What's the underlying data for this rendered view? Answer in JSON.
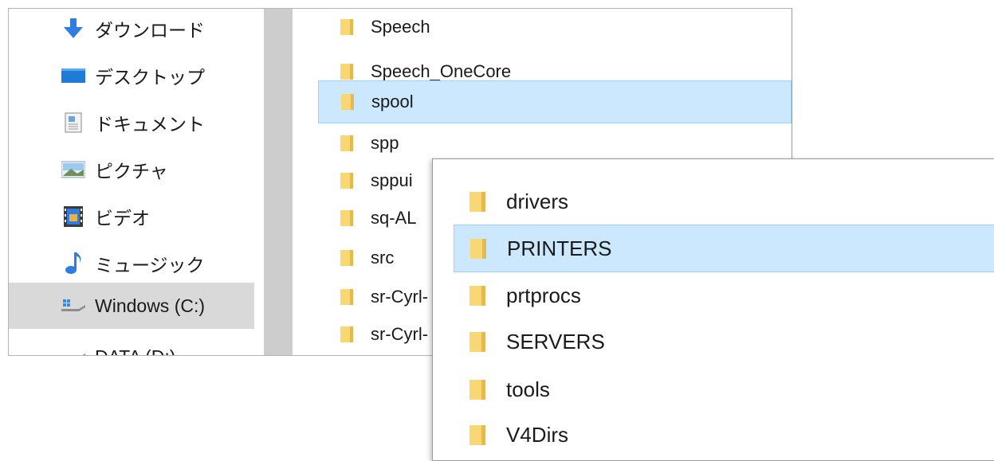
{
  "nav": {
    "items": [
      {
        "label": "ダウンロード",
        "icon": "download-arrow-icon"
      },
      {
        "label": "デスクトップ",
        "icon": "desktop-icon"
      },
      {
        "label": "ドキュメント",
        "icon": "document-icon"
      },
      {
        "label": "ピクチャ",
        "icon": "pictures-icon"
      },
      {
        "label": "ビデオ",
        "icon": "video-icon"
      },
      {
        "label": "ミュージック",
        "icon": "music-note-icon"
      },
      {
        "label": "Windows (C:)",
        "icon": "drive-icon",
        "selected": true
      },
      {
        "label": "DATA (D:)",
        "icon": "drive-icon"
      }
    ]
  },
  "files": [
    {
      "name": "Speech"
    },
    {
      "name": "Speech_OneCore"
    },
    {
      "name": "spool",
      "selected": true
    },
    {
      "name": "spp"
    },
    {
      "name": "sppui"
    },
    {
      "name": "sq-AL"
    },
    {
      "name": "src"
    },
    {
      "name": "sr-Cyrl-"
    },
    {
      "name": "sr-Cyrl-"
    }
  ],
  "spool_folder": {
    "items": [
      {
        "name": "drivers"
      },
      {
        "name": "PRINTERS",
        "selected": true
      },
      {
        "name": "prtprocs"
      },
      {
        "name": "SERVERS"
      },
      {
        "name": "tools"
      },
      {
        "name": "V4Dirs"
      }
    ]
  },
  "colors": {
    "selection": "#cce8ff",
    "selection_border": "#99d1ff",
    "nav_selected": "#d9d9d9",
    "folder_yellow": "#f8d775",
    "download_blue": "#2f7de1"
  }
}
